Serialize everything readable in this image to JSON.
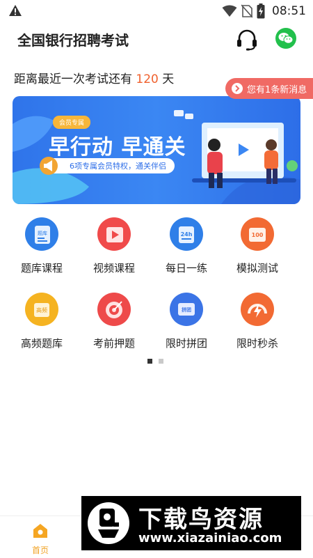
{
  "status_bar": {
    "time": "08:51",
    "icons": [
      "warning-icon",
      "wifi-icon",
      "no-sim-icon",
      "battery-charging-icon"
    ]
  },
  "header": {
    "title": "全国银行招聘考试",
    "icons": [
      "headset-icon",
      "wechat-icon"
    ]
  },
  "countdown": {
    "prefix": "距离最近一次考试还有",
    "days": "120",
    "suffix": "天"
  },
  "message": {
    "text": "您有1条新消息"
  },
  "banner": {
    "badge": "会员专属",
    "headline": "早行动  早通关",
    "subtitle": "6项专属会员特权，通关伴侣"
  },
  "grid": {
    "items": [
      {
        "label": "题库课程",
        "icon": "question-bank-icon",
        "color": "#2f7fe8",
        "icon_text": "题库"
      },
      {
        "label": "视频课程",
        "icon": "video-play-icon",
        "color": "#f04a4a",
        "icon_text": ""
      },
      {
        "label": "每日一练",
        "icon": "daily-calendar-icon",
        "color": "#2f7fe8",
        "icon_text": "24h"
      },
      {
        "label": "模拟测试",
        "icon": "mock-test-icon",
        "color": "#f26a33",
        "icon_text": "100"
      },
      {
        "label": "高频题库",
        "icon": "high-frequency-icon",
        "color": "#f5b321",
        "icon_text": "高频"
      },
      {
        "label": "考前押题",
        "icon": "target-icon",
        "color": "#ee4a4a",
        "icon_text": ""
      },
      {
        "label": "限时拼团",
        "icon": "group-buy-icon",
        "color": "#3b74e6",
        "icon_text": "拼团"
      },
      {
        "label": "限时秒杀",
        "icon": "flash-sale-icon",
        "color": "#f26a33",
        "icon_text": ""
      }
    ]
  },
  "pagination": {
    "pages": 2,
    "active": 1
  },
  "bottom_nav": {
    "home_label": "首页"
  },
  "watermark": {
    "title": "下载鸟资源",
    "url": "www.xiazainiao.com"
  }
}
